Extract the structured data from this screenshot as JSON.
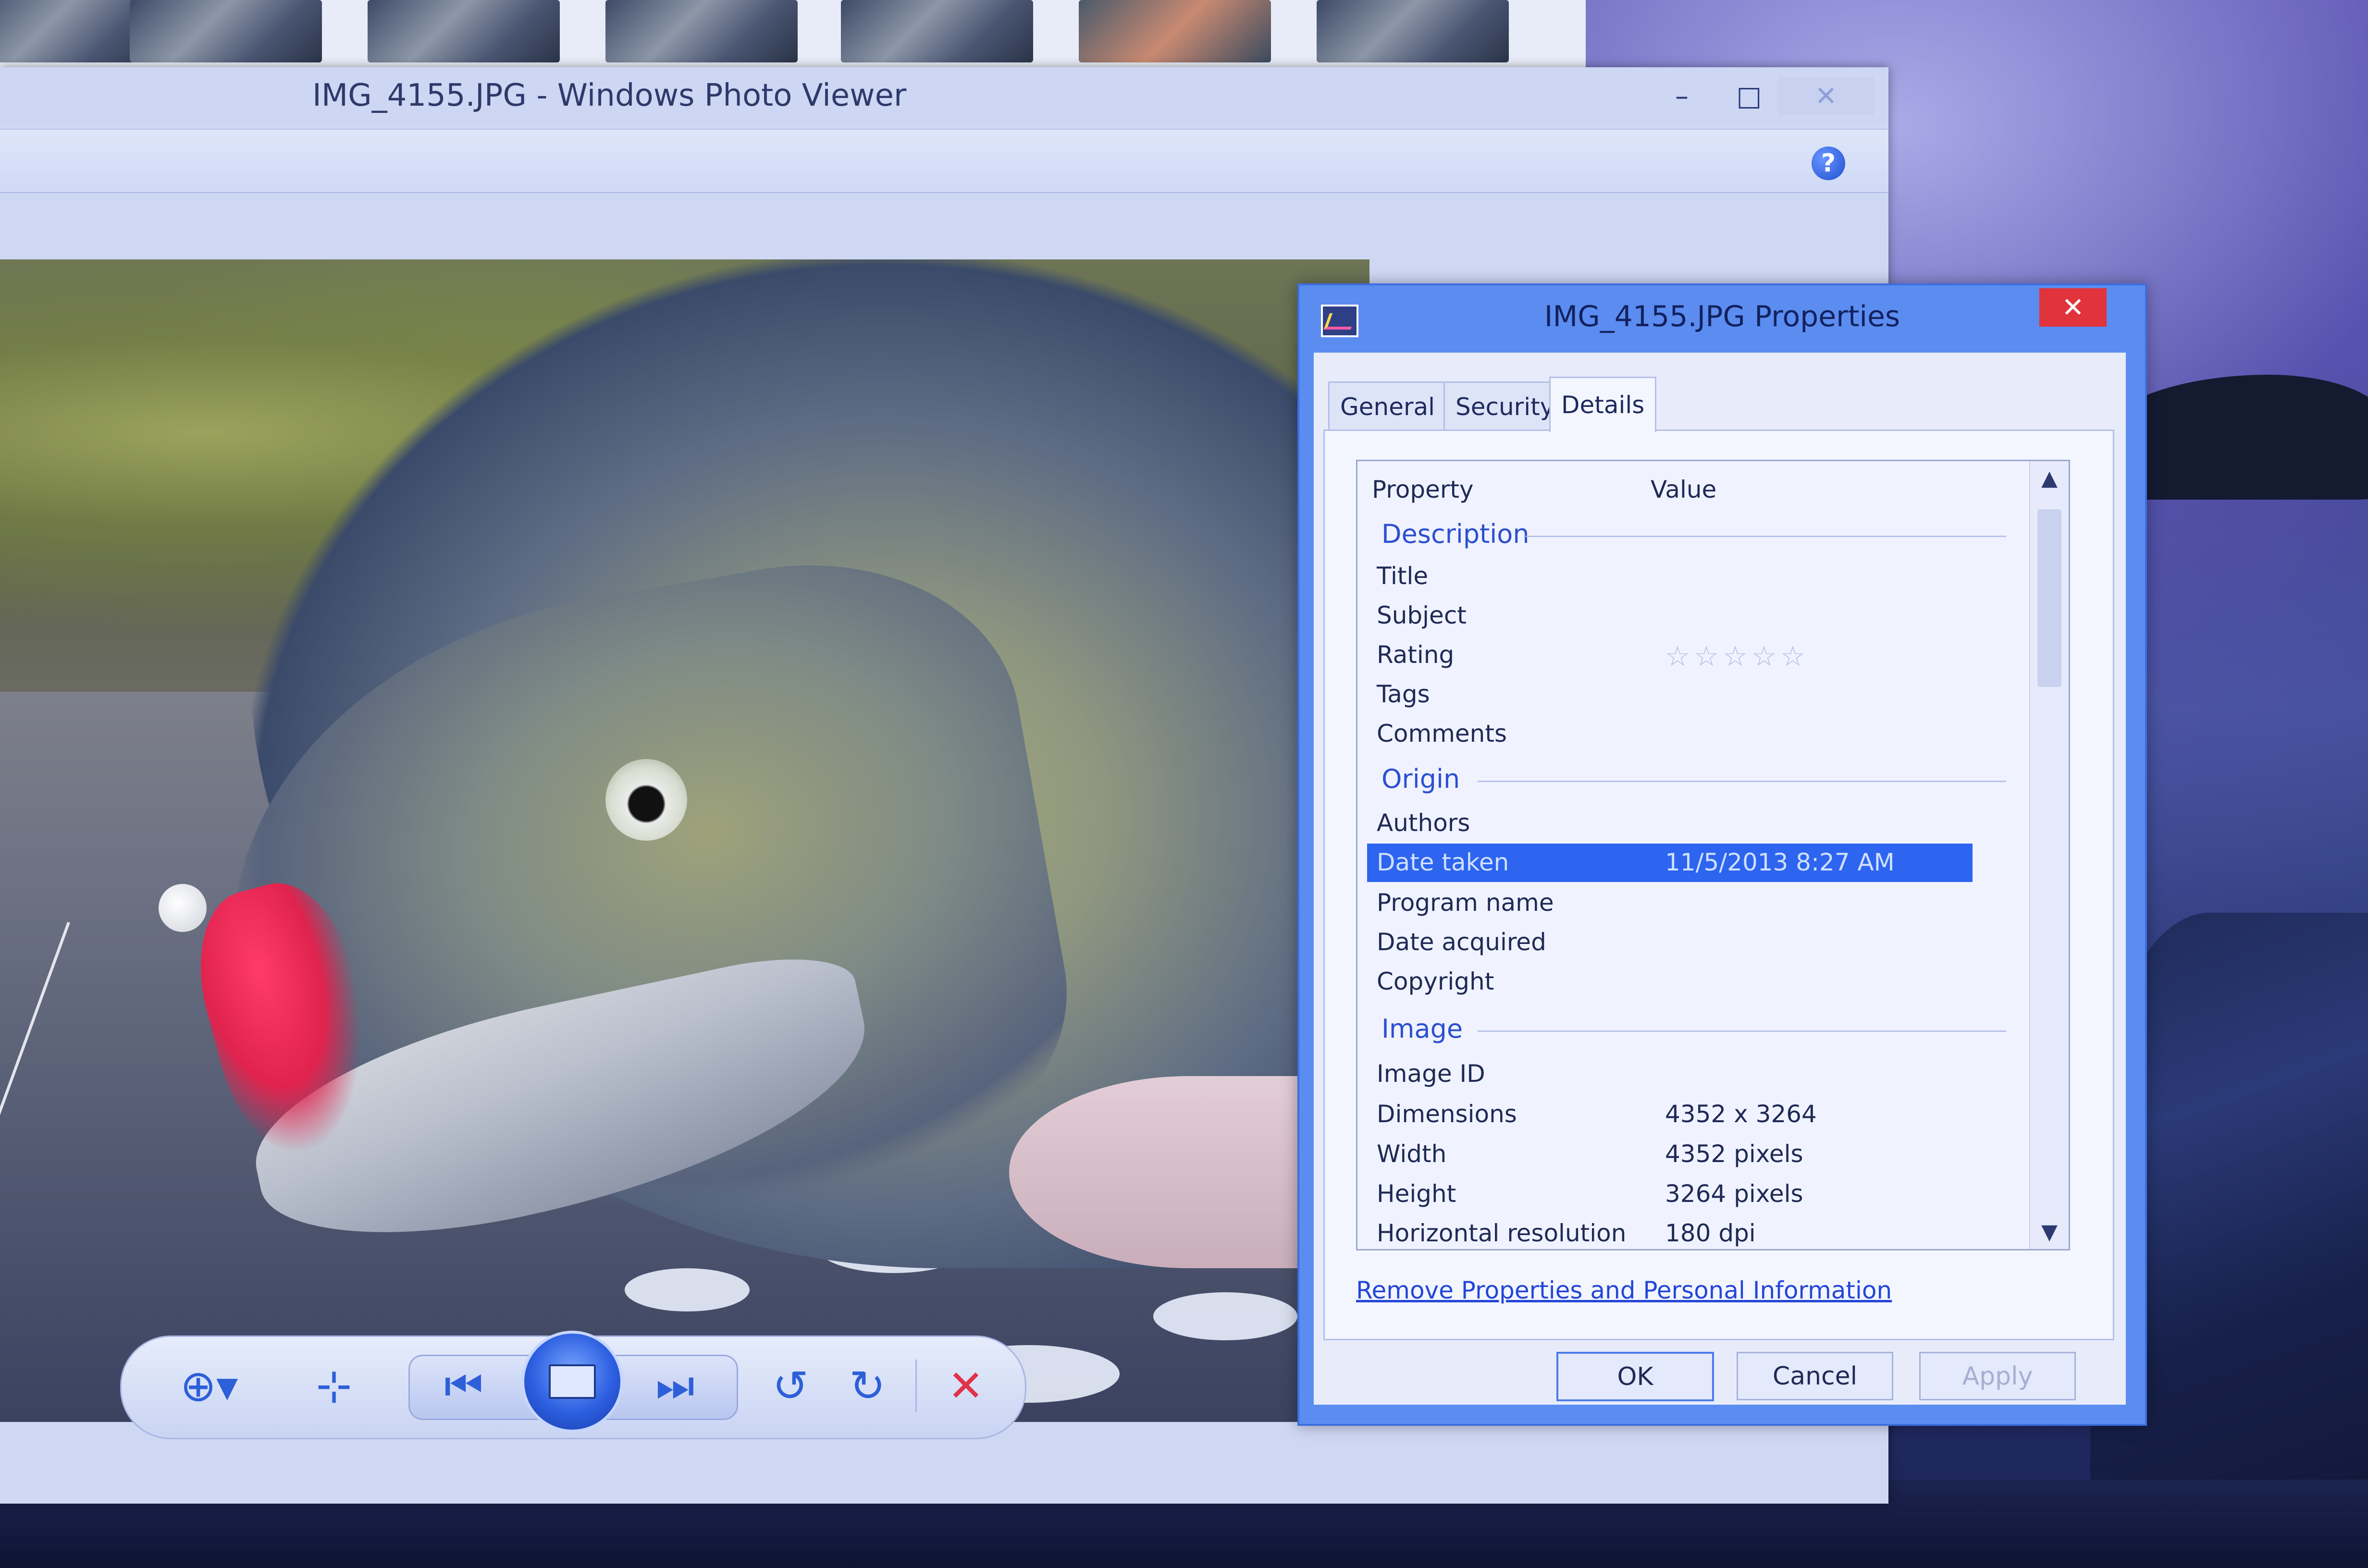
{
  "viewer": {
    "title": "IMG_4155.JPG - Windows Photo Viewer",
    "minimize": "–",
    "maximize": "□",
    "close": "✕",
    "help": "?"
  },
  "toolbar": {
    "zoom": "⊕▾",
    "fit": "⊹",
    "previous": "⏮",
    "next": "⏭",
    "rotate_ccw": "↺",
    "rotate_cw": "↻",
    "delete": "✕"
  },
  "dialog": {
    "title": "IMG_4155.JPG Properties",
    "close": "✕",
    "tabs": [
      "General",
      "Security",
      "Details"
    ],
    "active_tab": "Details",
    "columns": {
      "property": "Property",
      "value": "Value"
    },
    "groups": {
      "description": "Description",
      "origin": "Origin",
      "image": "Image"
    },
    "rows": {
      "title": {
        "name": "Title",
        "value": ""
      },
      "subject": {
        "name": "Subject",
        "value": ""
      },
      "rating": {
        "name": "Rating",
        "stars": "☆☆☆☆☆"
      },
      "tags": {
        "name": "Tags",
        "value": ""
      },
      "comments": {
        "name": "Comments",
        "value": ""
      },
      "authors": {
        "name": "Authors",
        "value": ""
      },
      "date_taken": {
        "name": "Date taken",
        "value": "11/5/2013 8:27 AM"
      },
      "program_name": {
        "name": "Program name",
        "value": ""
      },
      "date_acquired": {
        "name": "Date acquired",
        "value": ""
      },
      "copyright": {
        "name": "Copyright",
        "value": ""
      },
      "image_id": {
        "name": "Image ID",
        "value": ""
      },
      "dimensions": {
        "name": "Dimensions",
        "value": "4352 x 3264"
      },
      "width": {
        "name": "Width",
        "value": "4352 pixels"
      },
      "height": {
        "name": "Height",
        "value": "3264 pixels"
      },
      "horizontal_resolution": {
        "name": "Horizontal resolution",
        "value": "180 dpi"
      }
    },
    "remove_link": "Remove Properties and Personal Information",
    "buttons": {
      "ok": "OK",
      "cancel": "Cancel",
      "apply": "Apply"
    },
    "scroll_up": "▲",
    "scroll_down": "▼"
  },
  "colors": {
    "selection": "#2d64f0",
    "dialog_frame": "#5b8cf0",
    "close_red": "#e0333c",
    "link": "#2346d8"
  }
}
